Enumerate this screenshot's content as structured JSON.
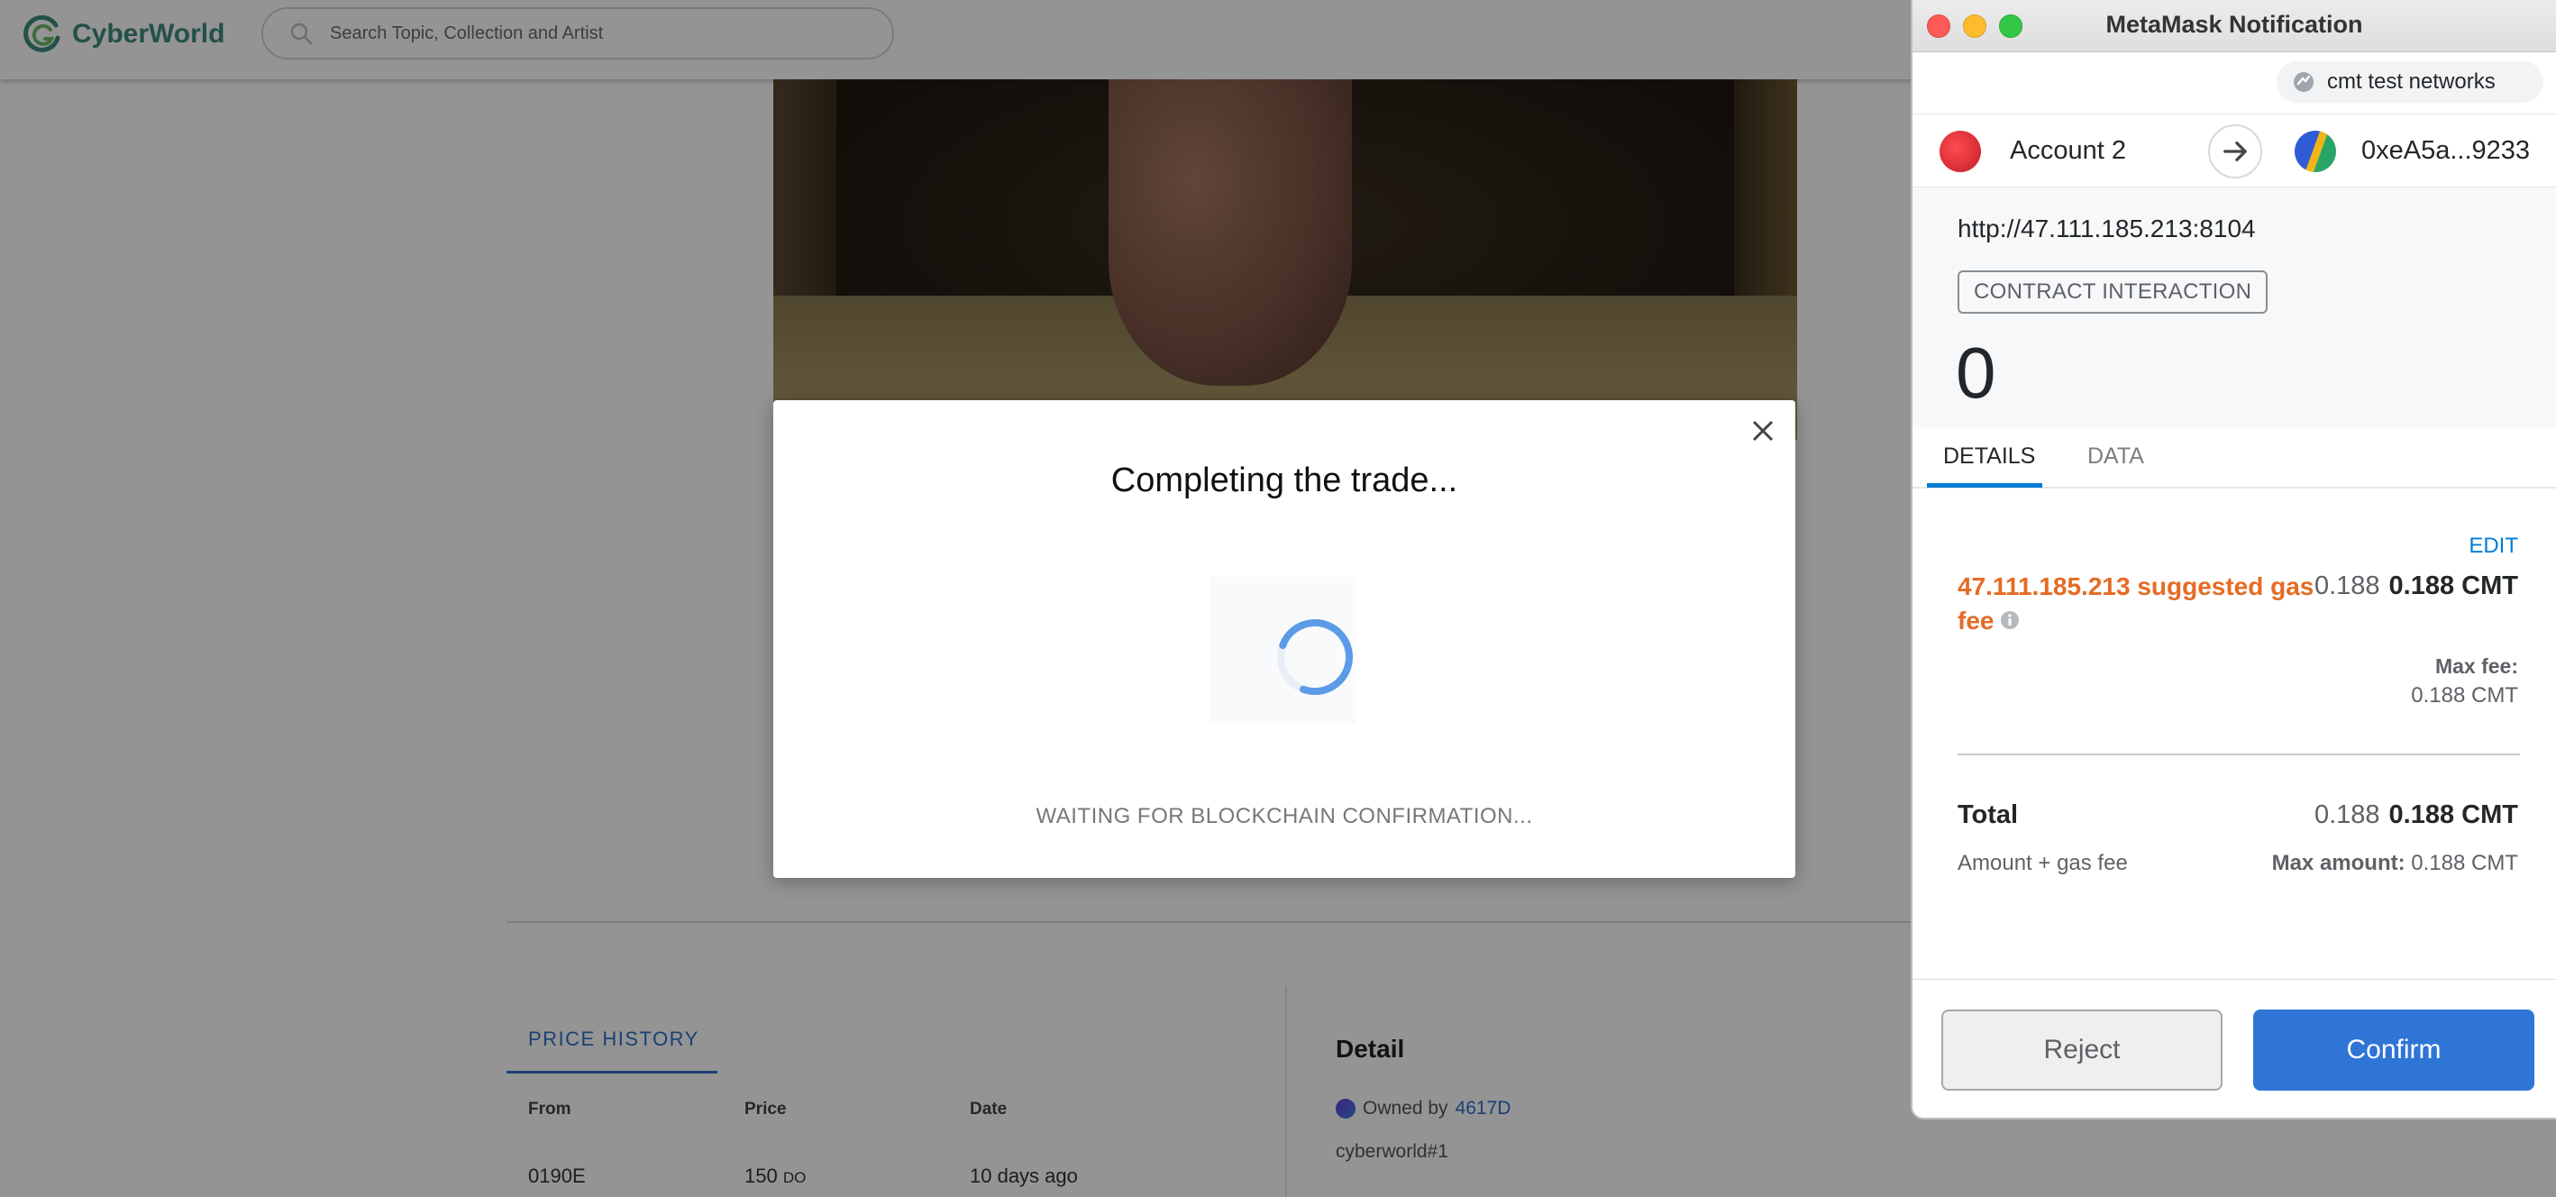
{
  "site": {
    "logo_text": "CyberWorld",
    "search_placeholder": "Search Topic, Collection and Artist"
  },
  "price_history": {
    "tab_label": "PRICE HISTORY",
    "columns": [
      "From",
      "Price",
      "Date"
    ],
    "rows": [
      {
        "from": "0190E",
        "price": "150",
        "unit": "DO",
        "date": "10 days ago"
      }
    ]
  },
  "detail": {
    "title": "Detail",
    "owned_by_label": "Owned by",
    "owner": "4617D",
    "token_id": "cyberworld#1"
  },
  "trade_modal": {
    "title": "Completing the trade...",
    "status": "WAITING FOR BLOCKCHAIN CONFIRMATION..."
  },
  "metamask": {
    "window_title": "MetaMask Notification",
    "network": "cmt test networks",
    "from_account": "Account 2",
    "to_address": "0xeA5a...9233",
    "origin": "http://47.111.185.213:8104",
    "interaction_type": "CONTRACT INTERACTION",
    "amount": "0",
    "tabs": [
      "DETAILS",
      "DATA"
    ],
    "active_tab": "DETAILS",
    "edit_label": "EDIT",
    "gas_fee_label": "47.111.185.213 suggested gas fee",
    "gas_fee_primary": "0.188",
    "gas_fee_secondary": "0.188 CMT",
    "max_fee_label": "Max fee:",
    "max_fee_value": "0.188 CMT",
    "total_label": "Total",
    "total_primary": "0.188",
    "total_secondary": "0.188 CMT",
    "total_sub": "Amount + gas fee",
    "max_amount_label": "Max amount:",
    "max_amount_value": "0.188 CMT",
    "reject_label": "Reject",
    "confirm_label": "Confirm"
  },
  "colors": {
    "brand": "#3d8a7c",
    "link": "#2f6fc9",
    "metamask_blue": "#037dd6",
    "confirm": "#2f75d6",
    "gas_warning": "#e56b24"
  }
}
